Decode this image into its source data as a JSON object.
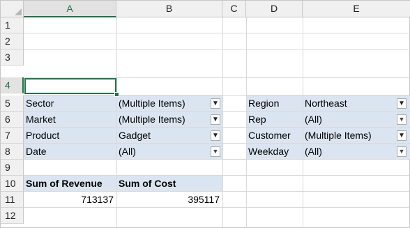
{
  "columns": [
    "A",
    "B",
    "C",
    "D",
    "E"
  ],
  "rows": [
    "1",
    "2",
    "3",
    "4",
    "5",
    "6",
    "7",
    "8",
    "9",
    "10",
    "11",
    "12"
  ],
  "active_cell": "A4",
  "colors": {
    "pivot_shading": "#dbe5f1",
    "selection_border": "#217346",
    "gridline": "#d9d9d9",
    "header_bg": "#f0f0f0"
  },
  "report_filters_left": [
    {
      "field": "Sector",
      "value": "(Multiple Items)",
      "filter_state": "filtered",
      "icon": "filter-applied-icon"
    },
    {
      "field": "Market",
      "value": "(Multiple Items)",
      "filter_state": "filtered",
      "icon": "filter-applied-icon"
    },
    {
      "field": "Product",
      "value": "Gadget",
      "filter_state": "filtered",
      "icon": "filter-applied-icon"
    },
    {
      "field": "Date",
      "value": "(All)",
      "filter_state": "all",
      "icon": "dropdown-arrow-icon"
    }
  ],
  "report_filters_right": [
    {
      "field": "Region",
      "value": "Northeast",
      "filter_state": "filtered",
      "icon": "filter-applied-icon"
    },
    {
      "field": "Rep",
      "value": "(All)",
      "filter_state": "all",
      "icon": "dropdown-arrow-icon"
    },
    {
      "field": "Customer",
      "value": "(Multiple Items)",
      "filter_state": "filtered",
      "icon": "filter-applied-icon"
    },
    {
      "field": "Weekday",
      "value": "(All)",
      "filter_state": "all",
      "icon": "dropdown-arrow-icon"
    }
  ],
  "values_area": {
    "headers": [
      "Sum of Revenue",
      "Sum of Cost"
    ],
    "totals": [
      "713137",
      "395117"
    ]
  }
}
